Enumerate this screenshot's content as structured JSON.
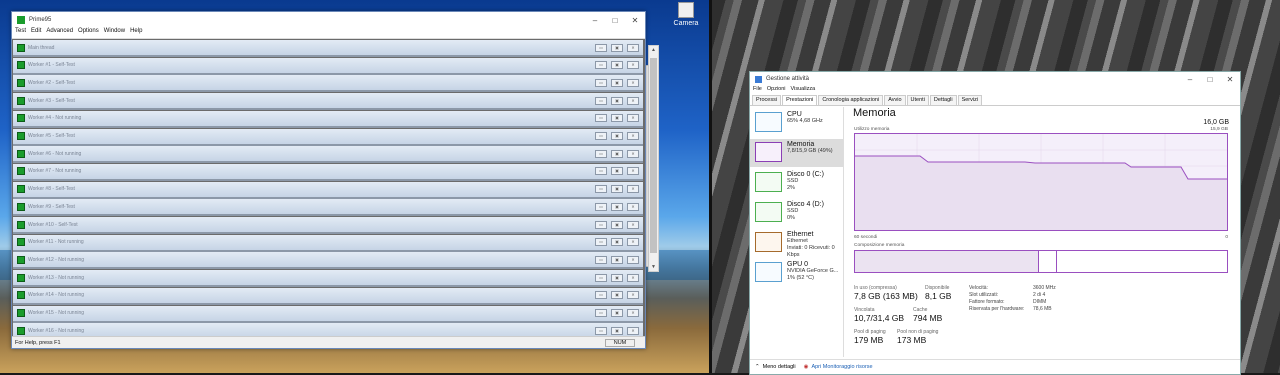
{
  "desktop": {
    "icon_label": "Camera"
  },
  "prime": {
    "title": "Prime95",
    "menu": [
      "Test",
      "Edit",
      "Advanced",
      "Options",
      "Window",
      "Help"
    ],
    "workers": [
      "Main thread",
      "Worker #1 - Self-Test",
      "Worker #2 - Self-Test",
      "Worker #3 - Self-Test",
      "Worker #4 - Not running",
      "Worker #5 - Self-Test",
      "Worker #6 - Not running",
      "Worker #7 - Not running",
      "Worker #8 - Self-Test",
      "Worker #9 - Self-Test",
      "Worker #10 - Self-Test",
      "Worker #11 - Not running",
      "Worker #12 - Not running",
      "Worker #13 - Not running",
      "Worker #14 - Not running",
      "Worker #15 - Not running",
      "Worker #16 - Not running"
    ],
    "status": "For Help, press F1",
    "num": "NUM"
  },
  "taskmgr": {
    "title": "Gestione attività",
    "menu": [
      "File",
      "Opzioni",
      "Visualizza"
    ],
    "tabs": [
      "Processi",
      "Prestazioni",
      "Cronologia applicazioni",
      "Avvio",
      "Utenti",
      "Dettagli",
      "Servizi"
    ],
    "resources": [
      {
        "name": "CPU",
        "sub1": "65%  4,68 GHz",
        "sub2": ""
      },
      {
        "name": "Memoria",
        "sub1": "7,8/15,9 GB (49%)",
        "sub2": ""
      },
      {
        "name": "Disco 0 (C:)",
        "sub1": "SSD",
        "sub2": "2%"
      },
      {
        "name": "Disco 4 (D:)",
        "sub1": "SSD",
        "sub2": "0%"
      },
      {
        "name": "Ethernet",
        "sub1": "Ethernet",
        "sub2": "Inviati: 0  Ricevuti: 0 Kbps"
      },
      {
        "name": "GPU 0",
        "sub1": "NVIDIA GeForce G...",
        "sub2": "1% (52 °C)"
      }
    ],
    "main": {
      "title": "Memoria",
      "total": "16,0 GB",
      "usage_label": "Utilizzo memoria",
      "usage_max": "15,9 GB",
      "time_label": "60 secondi",
      "time_zero": "0",
      "composition_label": "Composizione memoria"
    },
    "stats": {
      "in_use_label": "In uso (compressa)",
      "in_use": "7,8 GB (163 MB)",
      "available_label": "Disponibile",
      "available": "8,1 GB",
      "committed_label": "Vincolata",
      "committed": "10,7/31,4 GB",
      "cached_label": "Cache",
      "cached": "794 MB",
      "paged_label": "Pool di paging",
      "paged": "179 MB",
      "nonpaged_label": "Pool non di paging",
      "nonpaged": "173 MB"
    },
    "kv": [
      {
        "k": "Velocità:",
        "v": "3600 MHz"
      },
      {
        "k": "Slot utilizzati:",
        "v": "2 di 4"
      },
      {
        "k": "Fattore formato:",
        "v": "DIMM"
      },
      {
        "k": "Riservata per l'hardware:",
        "v": "78,6 MB"
      }
    ],
    "footer": {
      "less": "Meno dettagli",
      "monitor": "Apri Monitoraggio risorse"
    }
  }
}
